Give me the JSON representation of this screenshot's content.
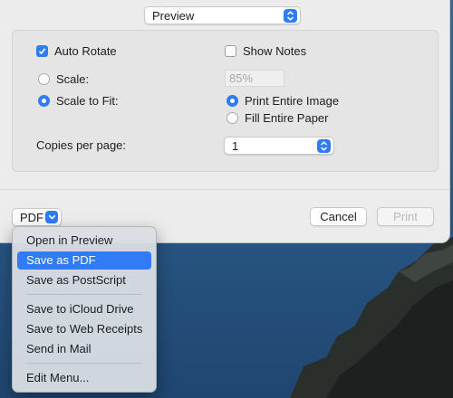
{
  "dialog": {
    "preset_popup": {
      "value": "Preview"
    },
    "options": {
      "auto_rotate": {
        "label": "Auto Rotate",
        "checked": true
      },
      "show_notes": {
        "label": "Show Notes",
        "checked": false
      },
      "scale": {
        "label": "Scale:",
        "selected": false,
        "value_placeholder": "85%"
      },
      "scale_to_fit": {
        "label": "Scale to Fit:",
        "selected": true
      },
      "print_entire_image": {
        "label": "Print Entire Image",
        "selected": true
      },
      "fill_entire_paper": {
        "label": "Fill Entire Paper",
        "selected": false
      },
      "copies_per_page": {
        "label": "Copies per page:",
        "value": "1"
      }
    },
    "footer": {
      "pdf_button": "PDF",
      "cancel_button": "Cancel",
      "print_button": "Print"
    }
  },
  "pdf_menu": {
    "items": [
      {
        "label": "Open in Preview",
        "selected": false
      },
      {
        "label": "Save as PDF",
        "selected": true
      },
      {
        "label": "Save as PostScript",
        "selected": false
      },
      {
        "label": "Save to iCloud Drive",
        "selected": false
      },
      {
        "label": "Save to Web Receipts",
        "selected": false
      },
      {
        "label": "Send in Mail",
        "selected": false
      },
      {
        "label": "Edit Menu...",
        "selected": false
      }
    ]
  },
  "colors": {
    "accent": "#2f7cf6",
    "dialog_bg": "#ececec",
    "panel_bg": "#e5e5e5"
  }
}
